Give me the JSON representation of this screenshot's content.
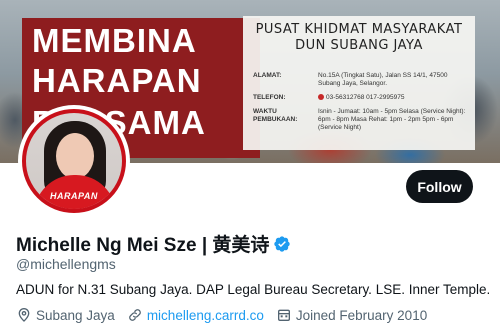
{
  "banner": {
    "slogan_lines": [
      "MEMBINA",
      "HARAPAN",
      "BERSAMA"
    ],
    "info_title_lines": [
      "PUSAT KHIDMAT MASYARAKAT",
      "DUN SUBANG JAYA"
    ],
    "alamat_label": "ALAMAT:",
    "alamat_value": "No.15A (Tingkat Satu), Jalan SS 14/1, 47500 Subang Jaya, Selangor.",
    "telefon_label": "TELEFON:",
    "telefon_value": "03-56312768   017-2995975",
    "waktu_label": "WAKTU PEMBUKAAN:",
    "waktu_value": "Isnin - Jumaat: 10am - 5pm  Selasa (Service Night): 6pm - 8pm  Masa Rehat: 1pm - 2pm  5pm - 6pm (Service Night)"
  },
  "avatar": {
    "logo_text": "HARAPAN"
  },
  "follow_button": {
    "label": "Follow"
  },
  "profile": {
    "display_name": "Michelle Ng Mei Sze | 黄美诗",
    "handle": "@michellengms",
    "bio": "ADUN for N.31 Subang Jaya. DAP Legal Bureau Secretary. LSE. Inner Temple.",
    "location": "Subang Jaya",
    "website": "michelleng.carrd.co",
    "joined": "Joined February 2010"
  },
  "colors": {
    "verified": "#1d9bf0",
    "link": "#1d9bf0",
    "follow_bg": "#0f1419",
    "banner_red": "#8e1d1f"
  },
  "icons": {
    "verified": "verified-badge-icon",
    "location": "location-pin-icon",
    "website": "link-icon",
    "joined": "calendar-icon"
  }
}
